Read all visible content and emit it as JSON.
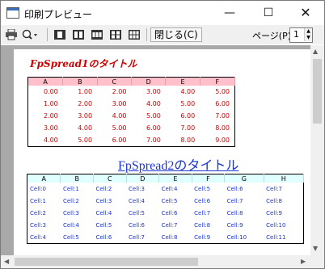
{
  "window": {
    "title": "印刷プレビュー"
  },
  "toolbar": {
    "close_label": "閉じる(C)",
    "page_label": "ページ(P)",
    "page_value": "1"
  },
  "sheet1": {
    "title": "FpSpread1のタイトル",
    "columns": [
      "A",
      "B",
      "C",
      "D",
      "E",
      "F"
    ],
    "rows": [
      [
        "0.00",
        "1.00",
        "2.00",
        "3.00",
        "4.00",
        "5.00"
      ],
      [
        "1.00",
        "2.00",
        "3.00",
        "4.00",
        "5.00",
        "6.00"
      ],
      [
        "2.00",
        "3.00",
        "4.00",
        "5.00",
        "6.00",
        "7.00"
      ],
      [
        "3.00",
        "4.00",
        "5.00",
        "6.00",
        "7.00",
        "8.00"
      ],
      [
        "4.00",
        "5.00",
        "6.00",
        "7.00",
        "8.00",
        "9.00"
      ]
    ]
  },
  "sheet2": {
    "title": "FpSpread2のタイトル",
    "columns": [
      "A",
      "B",
      "C",
      "D",
      "E",
      "F",
      "G",
      "H"
    ],
    "rows": [
      [
        "Cell:0",
        "Cell:1",
        "Cell:2",
        "Cell:3",
        "Cell:4",
        "Cell:5",
        "Cell:6",
        "Cell:7"
      ],
      [
        "Cell:1",
        "Cell:2",
        "Cell:3",
        "Cell:4",
        "Cell:5",
        "Cell:6",
        "Cell:7",
        "Cell:8"
      ],
      [
        "Cell:2",
        "Cell:3",
        "Cell:4",
        "Cell:5",
        "Cell:6",
        "Cell:7",
        "Cell:8",
        "Cell:9"
      ],
      [
        "Cell:3",
        "Cell:4",
        "Cell:5",
        "Cell:6",
        "Cell:7",
        "Cell:8",
        "Cell:9",
        "Cell:10"
      ],
      [
        "Cell:4",
        "Cell:5",
        "Cell:6",
        "Cell:7",
        "Cell:8",
        "Cell:9",
        "Cell:10",
        "Cell:11"
      ]
    ]
  }
}
